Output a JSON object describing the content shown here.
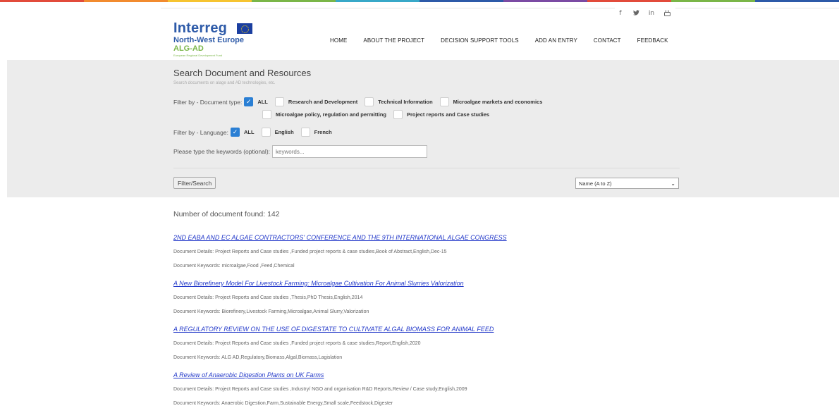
{
  "colors": {
    "strip": [
      "#e24b3b",
      "#f28b2f",
      "#f6c431",
      "#7ab648",
      "#38a8c8",
      "#2d5aa8",
      "#7b4aa3",
      "#e24b3b",
      "#7ab648",
      "#2d5aa8"
    ],
    "accent": "#2a7fd4",
    "link": "#2238c9",
    "panel": "#ececec"
  },
  "social": [
    {
      "name": "facebook-icon",
      "glyph": "f"
    },
    {
      "name": "twitter-icon",
      "glyph": "🐦"
    },
    {
      "name": "linkedin-icon",
      "glyph": "in"
    },
    {
      "name": "youtube-icon",
      "glyph": "▶"
    }
  ],
  "logo": {
    "interreg": "Interreg",
    "region": "North-West Europe",
    "project": "ALG-AD",
    "tagline": "European Regional Development Fund"
  },
  "nav": [
    "HOME",
    "ABOUT THE PROJECT",
    "DECISION SUPPORT TOOLS",
    "ADD AN ENTRY",
    "CONTACT",
    "FEEDBACK"
  ],
  "search": {
    "title": "Search Document and Resources",
    "subtitle": "Search documents on alage and AD technologies, etc.",
    "doc_type_label": "Filter by - Document type:",
    "doc_types": [
      {
        "label": "ALL",
        "checked": true
      },
      {
        "label": "Research and Development",
        "checked": false
      },
      {
        "label": "Technical Information",
        "checked": false
      },
      {
        "label": "Microalgae markets and economics",
        "checked": false
      },
      {
        "label": "Microalgae policy, regulation and permitting",
        "checked": false
      },
      {
        "label": "Project reports and Case studies",
        "checked": false
      }
    ],
    "lang_label": "Filter by - Language:",
    "languages": [
      {
        "label": "ALL",
        "checked": true
      },
      {
        "label": "English",
        "checked": false
      },
      {
        "label": "French",
        "checked": false
      }
    ],
    "keywords_label": "Please type the keywords (optional):",
    "keywords_placeholder": "keywords...",
    "button": "Filter/Search",
    "sort_selected": "Name (A to Z)"
  },
  "results": {
    "count_text": "Number of document found: 142",
    "documents": [
      {
        "title": "2ND EABA AND EC ALGAE CONTRACTORS' CONFERENCE AND THE 9TH INTERNATIONAL ALGAE CONGRESS",
        "details": "Document Details: Project Reports and Case studies ,Funded project reports & case studies,Book of Abstract,English,Dec-15",
        "keywords": "Document Keywords: microalgae,Food ,Feed,Chemical"
      },
      {
        "title": "A New Biorefinery Model For Livestock Farming: Microalgae Cultivation For Animal Slurries Valorization",
        "details": "Document Details: Project Reports and Case studies ,Thesis,PhD Thesis,English,2014",
        "keywords": "Document Keywords: Biorefinery,Livestock Farming,Microalgae,Animal Slurry,Valorization"
      },
      {
        "title": "A REGULATORY REVIEW ON THE USE OF DIGESTATE TO CULTIVATE ALGAL BIOMASS FOR ANIMAL FEED",
        "details": "Document Details: Project Reports and Case studies ,Funded project reports & case studies,Report,English,2020",
        "keywords": "Document Keywords: ALG AD,Regulatory,Biomass,Algal,Biomass,Lagislation"
      },
      {
        "title": "A Review of Anaerobic Digestion Plants on UK Farms",
        "details": "Document Details: Project Reports and Case studies ,Industry/ NGO and organisation R&D Reports,Review / Case study,English,2009",
        "keywords": "Document Keywords: Anaerobic Digestion,Farm,Sustainable Energy,Small scale,Feedstock,Digester"
      }
    ]
  }
}
